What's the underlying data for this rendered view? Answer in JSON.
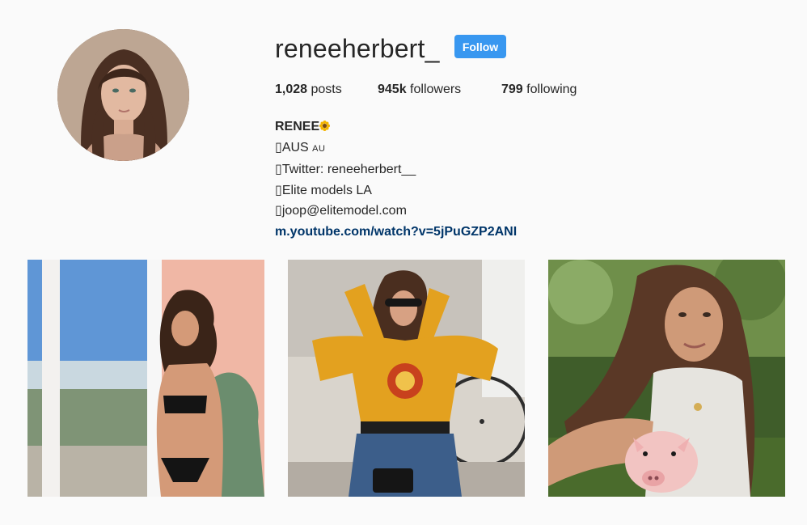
{
  "profile": {
    "username": "reneeherbert_",
    "follow_label": "Follow",
    "stats": {
      "posts_count": "1,028",
      "posts_label": "posts",
      "followers_count": "945k",
      "followers_label": "followers",
      "following_count": "799",
      "following_label": "following"
    },
    "bio": {
      "name": "RENEE",
      "lines": [
        {
          "prefix": "AUS ",
          "suffix": "AU"
        },
        {
          "prefix": "Twitter: reneeherbert__"
        },
        {
          "prefix": "Elite models LA"
        },
        {
          "prefix": "joop@elitemodel.com"
        }
      ],
      "link": "m.youtube.com/watch?v=5jPuGZP2ANI"
    }
  },
  "colors": {
    "background": "#fafafa",
    "follow_button": "#3897f0",
    "link": "#003569",
    "text": "#262626"
  },
  "icons": {
    "name_emoji": "sunflower-icon",
    "bio_line_glyph": "missing-glyph-icon"
  }
}
